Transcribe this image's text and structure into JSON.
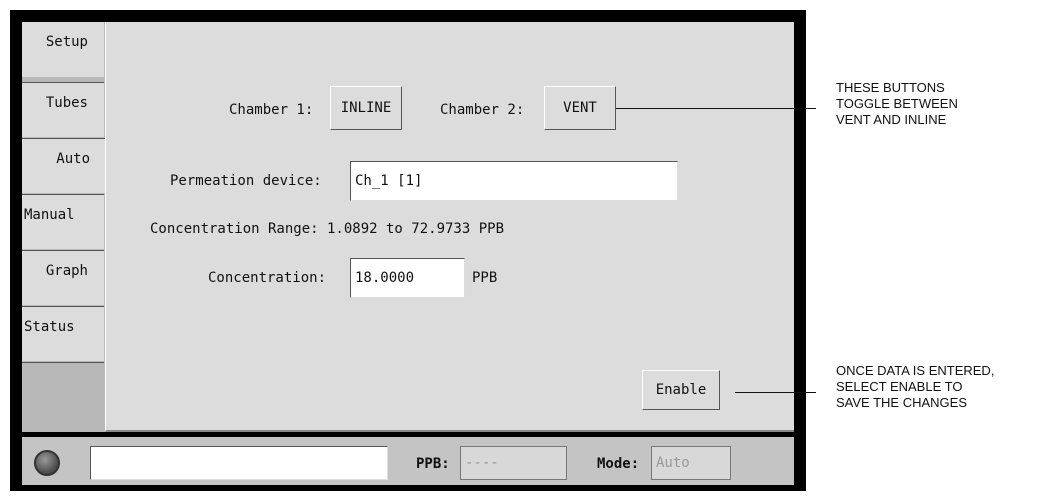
{
  "tabs": [
    {
      "label": "Setup"
    },
    {
      "label": "Tubes"
    },
    {
      "label": "Auto"
    },
    {
      "label": "Manual"
    },
    {
      "label": "Graph"
    },
    {
      "label": "Status"
    }
  ],
  "chambers": {
    "chamber1_label": "Chamber 1:",
    "chamber1_value": "INLINE",
    "chamber2_label": "Chamber 2:",
    "chamber2_value": "VENT"
  },
  "permeation": {
    "label": "Permeation device:",
    "value": "Ch_1 [1]"
  },
  "range": {
    "text": "Concentration Range: 1.0892 to 72.9733 PPB"
  },
  "concentration": {
    "label": "Concentration:",
    "value": "18.0000",
    "unit": "PPB"
  },
  "enable_label": "Enable",
  "status": {
    "message": "",
    "ppb_label": "PPB:",
    "ppb_value": "----",
    "mode_label": "Mode:",
    "mode_value": "Auto"
  },
  "annotations": {
    "buttons_line1": "THESE BUTTONS",
    "buttons_line2": "TOGGLE BETWEEN",
    "buttons_line3": "VENT AND INLINE",
    "enable_line1": "ONCE DATA IS ENTERED,",
    "enable_line2": "SELECT ENABLE TO",
    "enable_line3": "SAVE THE CHANGES"
  }
}
